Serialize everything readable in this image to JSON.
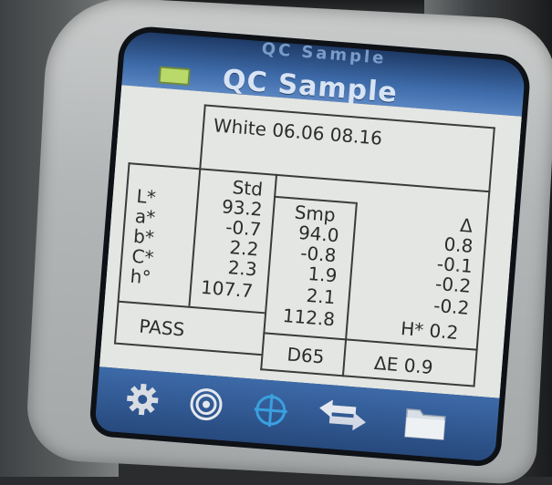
{
  "screen": {
    "top_partial_title": "QC Sample",
    "title": "QC Sample",
    "sample_name": "White 06.06 08.16"
  },
  "table": {
    "row_labels": [
      "L*",
      "a*",
      "b*",
      "C*",
      "h°"
    ],
    "std_header": "Std",
    "std_values": [
      "93.2",
      "-0.7",
      "2.2",
      "2.3",
      "107.7"
    ],
    "smp_header": "Smp",
    "smp_values": [
      "94.0",
      "-0.8",
      "1.9",
      "2.1",
      "112.8"
    ],
    "delta_header": "Δ",
    "delta_values": [
      "0.8",
      "-0.1",
      "-0.2",
      "-0.2"
    ],
    "delta_h": "H* 0.2",
    "status": "PASS",
    "illuminant": "D65",
    "delta_e": "ΔE 0.9"
  },
  "toolbar": {
    "icons": [
      "gear-icon",
      "target-icon",
      "crosshair-icon",
      "swap-arrows-icon",
      "folder-icon"
    ]
  },
  "colors": {
    "title_bar": "#3d6aa8",
    "screen_bg": "#e4e6e3",
    "battery": "#b9d96a",
    "crosshair": "#3aa0e0"
  }
}
